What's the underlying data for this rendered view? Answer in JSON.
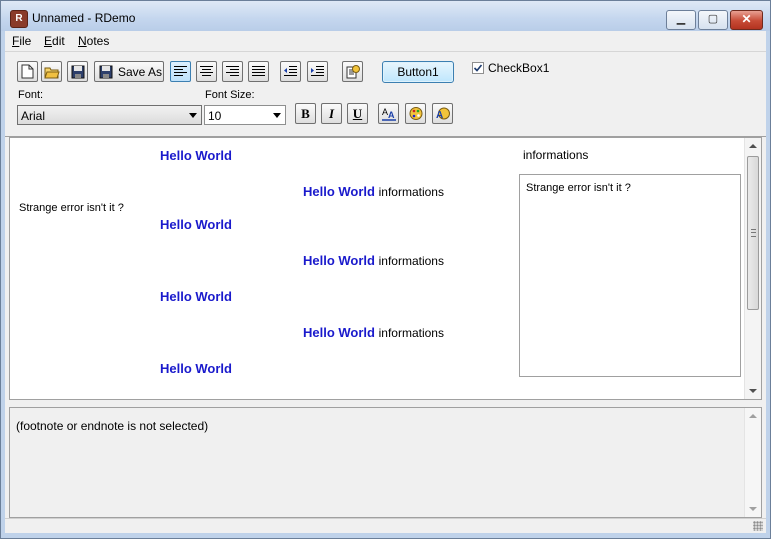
{
  "window": {
    "title": "Unnamed - RDemo"
  },
  "menu": [
    {
      "label": "File",
      "accel": "F",
      "rest": "ile"
    },
    {
      "label": "Edit",
      "accel": "E",
      "rest": "dit"
    },
    {
      "label": "Notes",
      "accel": "N",
      "rest": "otes"
    }
  ],
  "toolbar": {
    "save_as_label": "Save As",
    "button1_label": "Button1",
    "checkbox_label": "CheckBox1",
    "checkbox_checked": true,
    "font_label": "Font:",
    "font_value": "Arial",
    "font_size_label": "Font Size:",
    "font_size_value": "10",
    "bold_label": "B",
    "italic_label": "I",
    "underline_label": "U",
    "active_alignment": "left"
  },
  "editor": {
    "hello": "Hello World",
    "info": "informations",
    "error_text": "Strange error isn't it ?",
    "memo_text": "Strange error isn't it ?"
  },
  "notes": {
    "status_text": "(footnote or endnote is not selected)"
  },
  "colors": {
    "hello_world": "#1a1acc",
    "title_bar": "#c4d6ee"
  }
}
